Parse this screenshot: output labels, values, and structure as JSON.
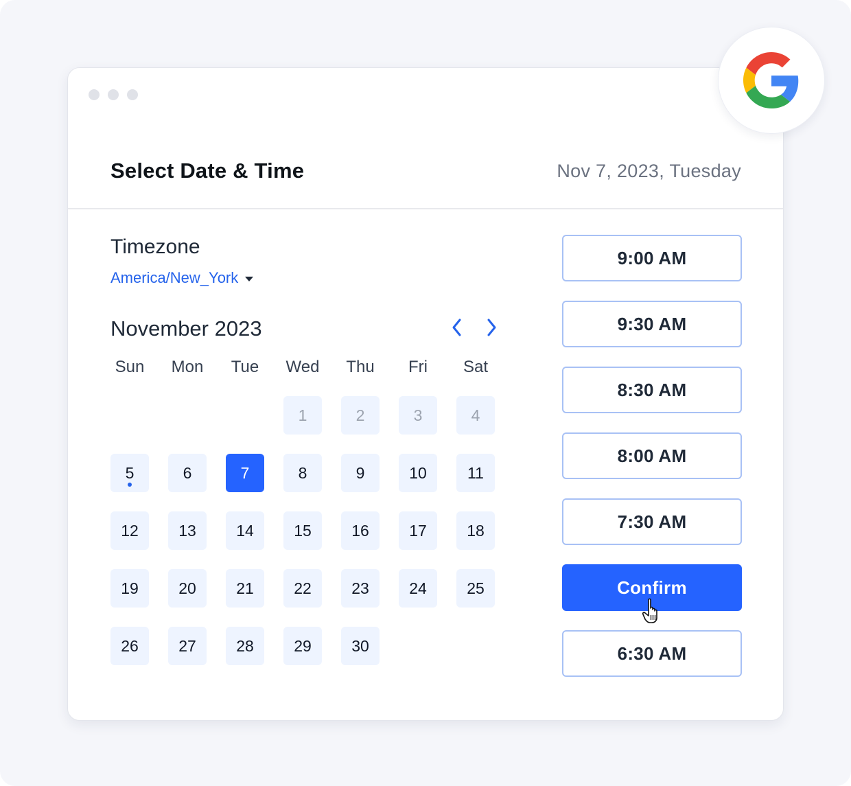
{
  "window": {
    "title": "Select Date & Time",
    "selected_date_label": "Nov 7, 2023, Tuesday"
  },
  "timezone": {
    "label": "Timezone",
    "value": "America/New_York"
  },
  "calendar": {
    "month_label": "November 2023",
    "prev_icon": "chevron-left-icon",
    "next_icon": "chevron-right-icon",
    "weekdays": [
      "Sun",
      "Mon",
      "Tue",
      "Wed",
      "Thu",
      "Fri",
      "Sat"
    ],
    "leading_empty": 3,
    "days": [
      {
        "n": "1",
        "state": "disabled"
      },
      {
        "n": "2",
        "state": "disabled"
      },
      {
        "n": "3",
        "state": "disabled"
      },
      {
        "n": "4",
        "state": "disabled"
      },
      {
        "n": "5",
        "state": "available",
        "has_event": true
      },
      {
        "n": "6",
        "state": "available"
      },
      {
        "n": "7",
        "state": "selected"
      },
      {
        "n": "8",
        "state": "available"
      },
      {
        "n": "9",
        "state": "available"
      },
      {
        "n": "10",
        "state": "available"
      },
      {
        "n": "11",
        "state": "available"
      },
      {
        "n": "12",
        "state": "available"
      },
      {
        "n": "13",
        "state": "available"
      },
      {
        "n": "14",
        "state": "available"
      },
      {
        "n": "15",
        "state": "available"
      },
      {
        "n": "16",
        "state": "available"
      },
      {
        "n": "17",
        "state": "available"
      },
      {
        "n": "18",
        "state": "available"
      },
      {
        "n": "19",
        "state": "available"
      },
      {
        "n": "20",
        "state": "available"
      },
      {
        "n": "21",
        "state": "available"
      },
      {
        "n": "22",
        "state": "available"
      },
      {
        "n": "23",
        "state": "available"
      },
      {
        "n": "24",
        "state": "available"
      },
      {
        "n": "25",
        "state": "available"
      },
      {
        "n": "26",
        "state": "available"
      },
      {
        "n": "27",
        "state": "available"
      },
      {
        "n": "28",
        "state": "available"
      },
      {
        "n": "29",
        "state": "available"
      },
      {
        "n": "30",
        "state": "available"
      }
    ]
  },
  "time_slots": [
    {
      "label": "9:00 AM",
      "type": "slot"
    },
    {
      "label": "9:30 AM",
      "type": "slot"
    },
    {
      "label": "8:30 AM",
      "type": "slot"
    },
    {
      "label": "8:00 AM",
      "type": "slot"
    },
    {
      "label": "7:30 AM",
      "type": "slot"
    },
    {
      "label": "Confirm",
      "type": "confirm"
    },
    {
      "label": "6:30 AM",
      "type": "slot"
    }
  ],
  "colors": {
    "accent": "#2563ff",
    "link": "#2563eb",
    "day_bg": "#eef4ff",
    "slot_border": "#a8c1f5"
  },
  "badge": {
    "icon": "google-icon"
  }
}
